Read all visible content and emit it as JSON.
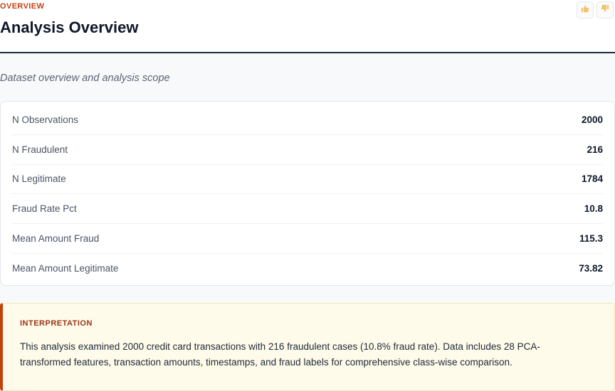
{
  "header": {
    "eyebrow": "OVERVIEW",
    "title": "Analysis Overview",
    "thumbs_up_icon": "thumbs-up-icon",
    "thumbs_down_icon": "thumbs-down-icon"
  },
  "subtitle": "Dataset overview and analysis scope",
  "stats": [
    {
      "label": "N Observations",
      "value": "2000"
    },
    {
      "label": "N Fraudulent",
      "value": "216"
    },
    {
      "label": "N Legitimate",
      "value": "1784"
    },
    {
      "label": "Fraud Rate Pct",
      "value": "10.8"
    },
    {
      "label": "Mean Amount Fraud",
      "value": "115.3"
    },
    {
      "label": "Mean Amount Legitimate",
      "value": "73.82"
    }
  ],
  "interpretation": {
    "heading": "INTERPRETATION",
    "text": "This analysis examined 2000 credit card transactions with 216 fraudulent cases (10.8% fraud rate). Data includes 28 PCA-transformed features, transaction amounts, timestamps, and fraud labels for comprehensive class-wise comparison."
  },
  "colors": {
    "accent": "#c2410c",
    "header_rule": "#1e293b",
    "interpretation_bg": "#fefbea"
  }
}
